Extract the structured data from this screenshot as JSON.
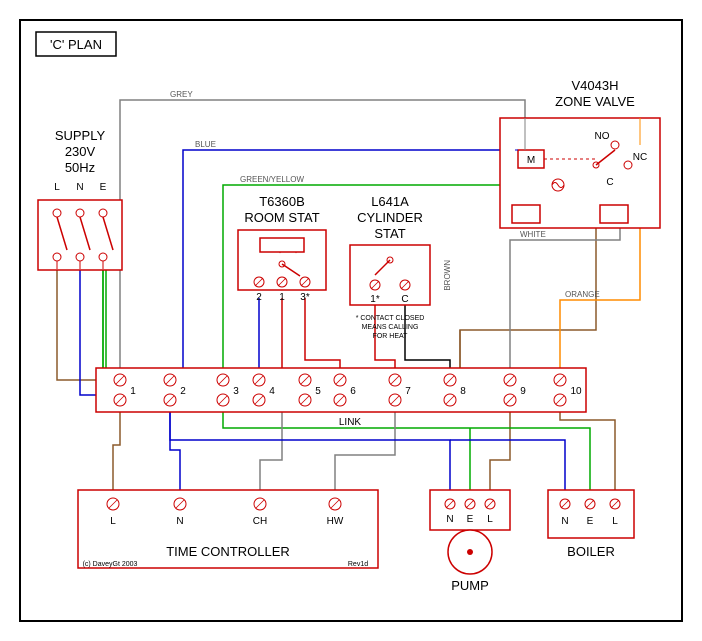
{
  "title": "'C' PLAN",
  "supply": {
    "label": "SUPPLY",
    "voltage": "230V",
    "freq": "50Hz",
    "terminals": [
      "L",
      "N",
      "E"
    ]
  },
  "roomstat": {
    "model": "T6360B",
    "label": "ROOM STAT",
    "terminals": [
      "2",
      "1",
      "3*"
    ]
  },
  "cylstat": {
    "model": "L641A",
    "label": "CYLINDER",
    "label2": "STAT",
    "terminals": [
      "1*",
      "C"
    ],
    "note1": "* CONTACT CLOSED",
    "note2": "MEANS CALLING",
    "note3": "FOR HEAT"
  },
  "zonevalve": {
    "model": "V4043H",
    "label": "ZONE VALVE",
    "no": "NO",
    "nc": "NC",
    "c": "C",
    "m": "M"
  },
  "junction": {
    "terminals": [
      "1",
      "2",
      "3",
      "4",
      "5",
      "6",
      "7",
      "8",
      "9",
      "10"
    ],
    "link": "LINK"
  },
  "timecontroller": {
    "label": "TIME CONTROLLER",
    "terminals": [
      "L",
      "N",
      "CH",
      "HW"
    ],
    "copyright": "(c) DaveyGt 2003",
    "rev": "Rev1d"
  },
  "pump": {
    "label": "PUMP",
    "terminals": [
      "N",
      "E",
      "L"
    ]
  },
  "boiler": {
    "label": "BOILER",
    "terminals": [
      "N",
      "E",
      "L"
    ]
  },
  "wires": {
    "grey": "GREY",
    "blue": "BLUE",
    "green": "GREEN/YELLOW",
    "brown": "BROWN",
    "white": "WHITE",
    "orange": "ORANGE"
  }
}
